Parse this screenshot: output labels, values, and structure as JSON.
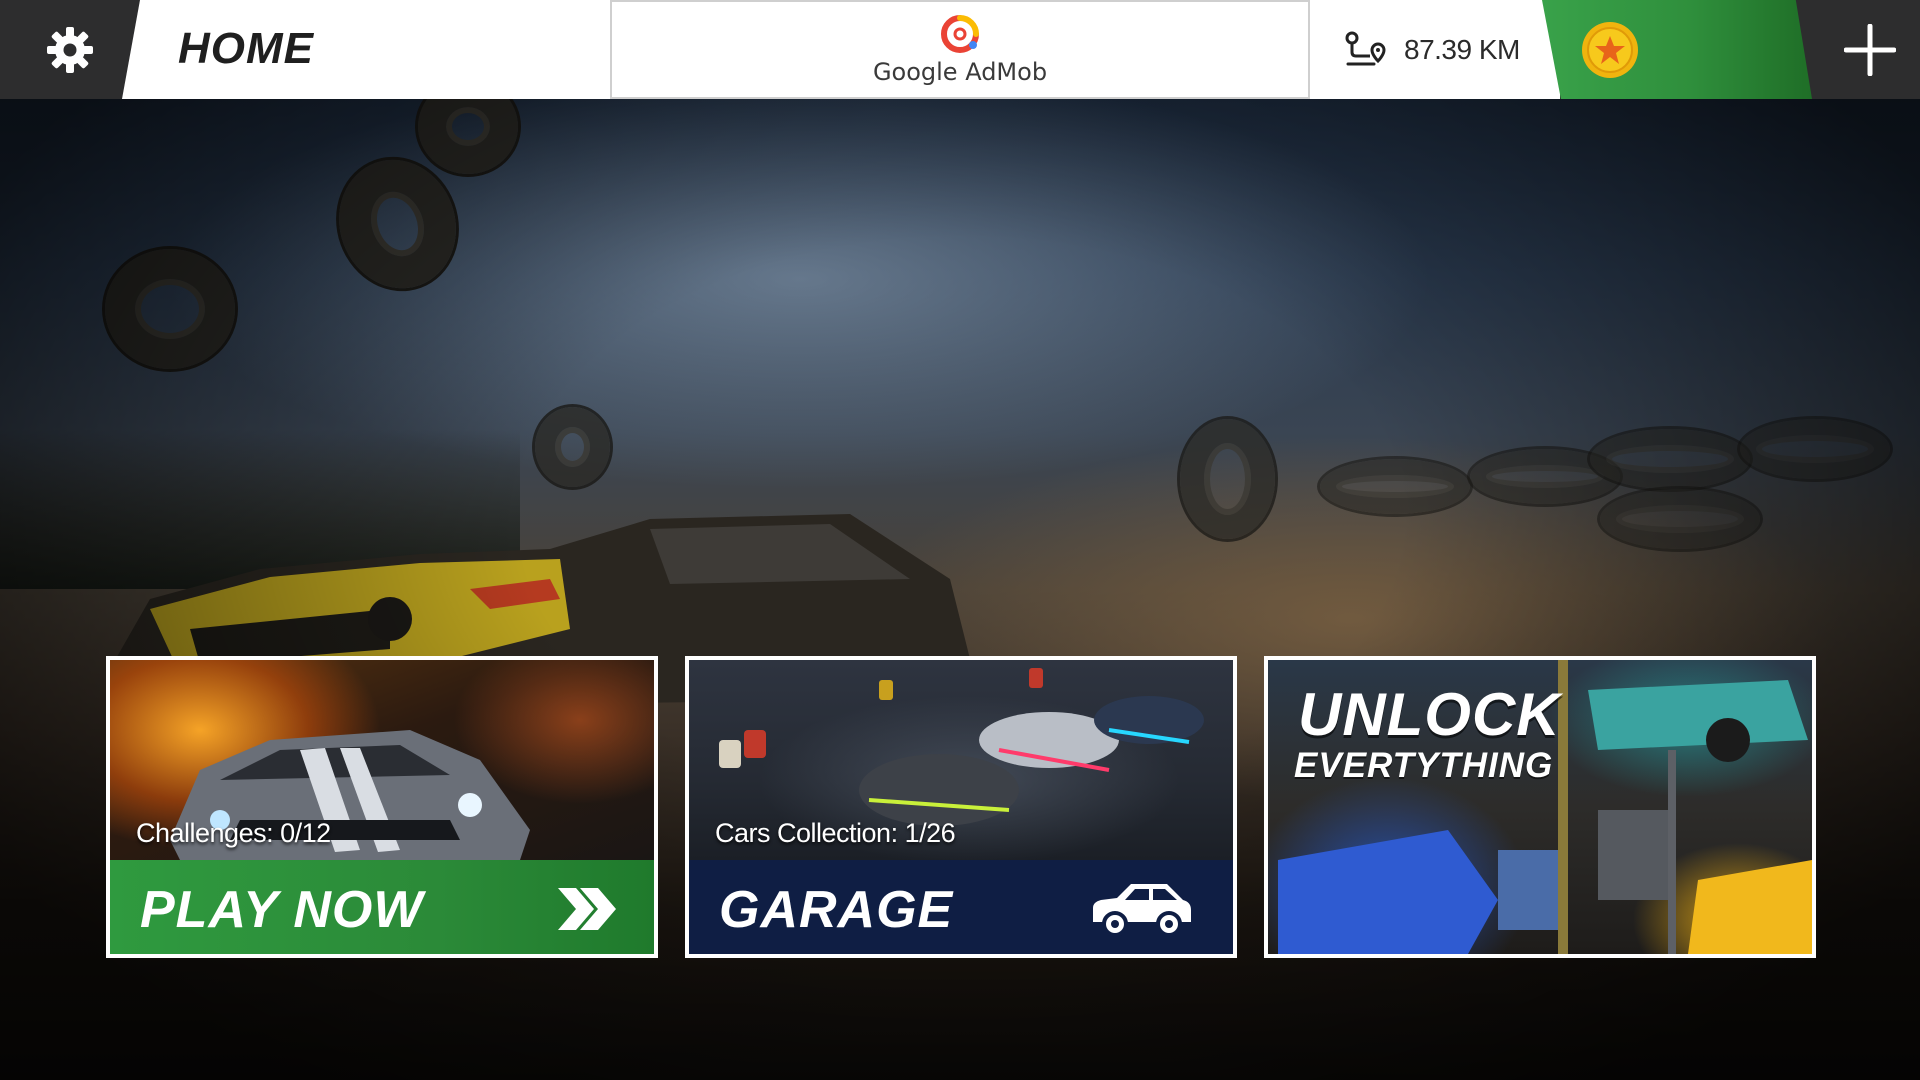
{
  "header": {
    "home_label": "HOME",
    "ad_label": "Google AdMob",
    "distance": "87.39 KM",
    "coins": ""
  },
  "icons": {
    "settings": "gear-icon",
    "ad": "admob-logo",
    "distance": "route-icon",
    "coin": "coin-star-icon",
    "add": "plus-icon",
    "play_arrows": "double-chevron-right-icon",
    "garage_car": "car-icon"
  },
  "cards": {
    "play": {
      "caption": "Challenges: 0/12",
      "title": "PLAY NOW"
    },
    "garage": {
      "caption": "Cars Collection: 1/26",
      "title": "GARAGE"
    },
    "unlock": {
      "title_line1": "UNLOCK",
      "title_line2": "EVERTYTHING"
    }
  },
  "colors": {
    "topbar": "#2d2d2e",
    "coins_green": "#2f8f3c",
    "play_green": "#2f9a3f",
    "garage_navy": "#0f1e44",
    "coin_gold": "#f5c518"
  }
}
